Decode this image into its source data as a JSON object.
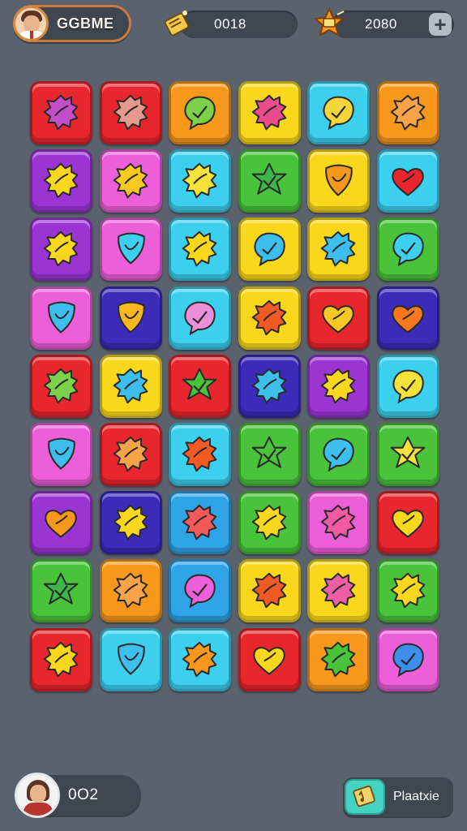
{
  "header": {
    "player_name": "GGBME",
    "score": "0018",
    "coins": "2080",
    "plus_label": "+"
  },
  "board": {
    "rows": 9,
    "cols": 6,
    "tiles": [
      [
        {
          "bg": "#e8262d",
          "c": "#c24fc8",
          "s": "splat"
        },
        {
          "bg": "#e8262d",
          "c": "#e69a8e",
          "s": "splat"
        },
        {
          "bg": "#f7981d",
          "c": "#7cd04a",
          "s": "bubble"
        },
        {
          "bg": "#f9d71c",
          "c": "#ee4b8f",
          "s": "splat"
        },
        {
          "bg": "#3dcfee",
          "c": "#f5d53c",
          "s": "bubble"
        },
        {
          "bg": "#f7981d",
          "c": "#f9a34a",
          "s": "splat"
        }
      ],
      [
        {
          "bg": "#9a35d3",
          "c": "#f9d71c",
          "s": "splat"
        },
        {
          "bg": "#ec5fd9",
          "c": "#f9c821",
          "s": "splat"
        },
        {
          "bg": "#3dcfee",
          "c": "#f5e23a",
          "s": "splat"
        },
        {
          "bg": "#49c43a",
          "c": "#3db64a",
          "s": "star"
        },
        {
          "bg": "#f9d71c",
          "c": "#f7981d",
          "s": "shield"
        },
        {
          "bg": "#3dcfee",
          "c": "#e8262d",
          "s": "heart"
        }
      ],
      [
        {
          "bg": "#9a35d3",
          "c": "#f9d71c",
          "s": "splat"
        },
        {
          "bg": "#ec5fd9",
          "c": "#3dcfee",
          "s": "shield"
        },
        {
          "bg": "#3dcfee",
          "c": "#f9d71c",
          "s": "splat"
        },
        {
          "bg": "#f9d71c",
          "c": "#3dbfee",
          "s": "bubble"
        },
        {
          "bg": "#f9d71c",
          "c": "#3dbfee",
          "s": "splat"
        },
        {
          "bg": "#49c43a",
          "c": "#3dcfee",
          "s": "bubble"
        }
      ],
      [
        {
          "bg": "#ec5fd9",
          "c": "#3dbfee",
          "s": "shield"
        },
        {
          "bg": "#3b2bb8",
          "c": "#f9b821",
          "s": "shield"
        },
        {
          "bg": "#3dcfee",
          "c": "#ec8fd9",
          "s": "bubble"
        },
        {
          "bg": "#f9d71c",
          "c": "#f25a24",
          "s": "splat"
        },
        {
          "bg": "#e8262d",
          "c": "#f9c821",
          "s": "heart"
        },
        {
          "bg": "#3b2bb8",
          "c": "#f7781d",
          "s": "heart"
        }
      ],
      [
        {
          "bg": "#e8262d",
          "c": "#7cd04a",
          "s": "splat"
        },
        {
          "bg": "#f9d71c",
          "c": "#3dbfee",
          "s": "splat"
        },
        {
          "bg": "#e8262d",
          "c": "#49c43a",
          "s": "star"
        },
        {
          "bg": "#3b2bb8",
          "c": "#3dbfee",
          "s": "splat"
        },
        {
          "bg": "#9a35d3",
          "c": "#f9d71c",
          "s": "splat"
        },
        {
          "bg": "#3dcfee",
          "c": "#f5e23a",
          "s": "bubble"
        }
      ],
      [
        {
          "bg": "#ec5fd9",
          "c": "#3dbfee",
          "s": "shield"
        },
        {
          "bg": "#e8262d",
          "c": "#f9a34a",
          "s": "splat"
        },
        {
          "bg": "#3dcfee",
          "c": "#f25a24",
          "s": "splat"
        },
        {
          "bg": "#49c43a",
          "c": "#49c43a",
          "s": "star"
        },
        {
          "bg": "#49c43a",
          "c": "#3dbfee",
          "s": "bubble"
        },
        {
          "bg": "#49c43a",
          "c": "#f5e23a",
          "s": "star"
        }
      ],
      [
        {
          "bg": "#9a35d3",
          "c": "#f7981d",
          "s": "heart"
        },
        {
          "bg": "#3b2bb8",
          "c": "#f9d71c",
          "s": "splat"
        },
        {
          "bg": "#2fa4e6",
          "c": "#f25a5a",
          "s": "splat"
        },
        {
          "bg": "#49c43a",
          "c": "#f9d71c",
          "s": "splat"
        },
        {
          "bg": "#ec5fd9",
          "c": "#f25aa4",
          "s": "splat"
        },
        {
          "bg": "#e8262d",
          "c": "#f9d71c",
          "s": "heart"
        }
      ],
      [
        {
          "bg": "#49c43a",
          "c": "#3db64a",
          "s": "star"
        },
        {
          "bg": "#f7981d",
          "c": "#f9a34a",
          "s": "splat"
        },
        {
          "bg": "#2fa4e6",
          "c": "#ec5fd9",
          "s": "bubble"
        },
        {
          "bg": "#f9d71c",
          "c": "#f25a24",
          "s": "splat"
        },
        {
          "bg": "#f9d71c",
          "c": "#ec5fa4",
          "s": "splat"
        },
        {
          "bg": "#49c43a",
          "c": "#f9d71c",
          "s": "splat"
        }
      ],
      [
        {
          "bg": "#e8262d",
          "c": "#f9d71c",
          "s": "splat"
        },
        {
          "bg": "#3dcfee",
          "c": "#3dbfee",
          "s": "shield"
        },
        {
          "bg": "#3dcfee",
          "c": "#f7981d",
          "s": "splat"
        },
        {
          "bg": "#e8262d",
          "c": "#f9d71c",
          "s": "heart"
        },
        {
          "bg": "#f7981d",
          "c": "#49c43a",
          "s": "splat"
        },
        {
          "bg": "#ec5fd9",
          "c": "#3d8fee",
          "s": "bubble"
        }
      ]
    ]
  },
  "footer": {
    "count": "0O2",
    "play_label": "Plaatxie"
  }
}
